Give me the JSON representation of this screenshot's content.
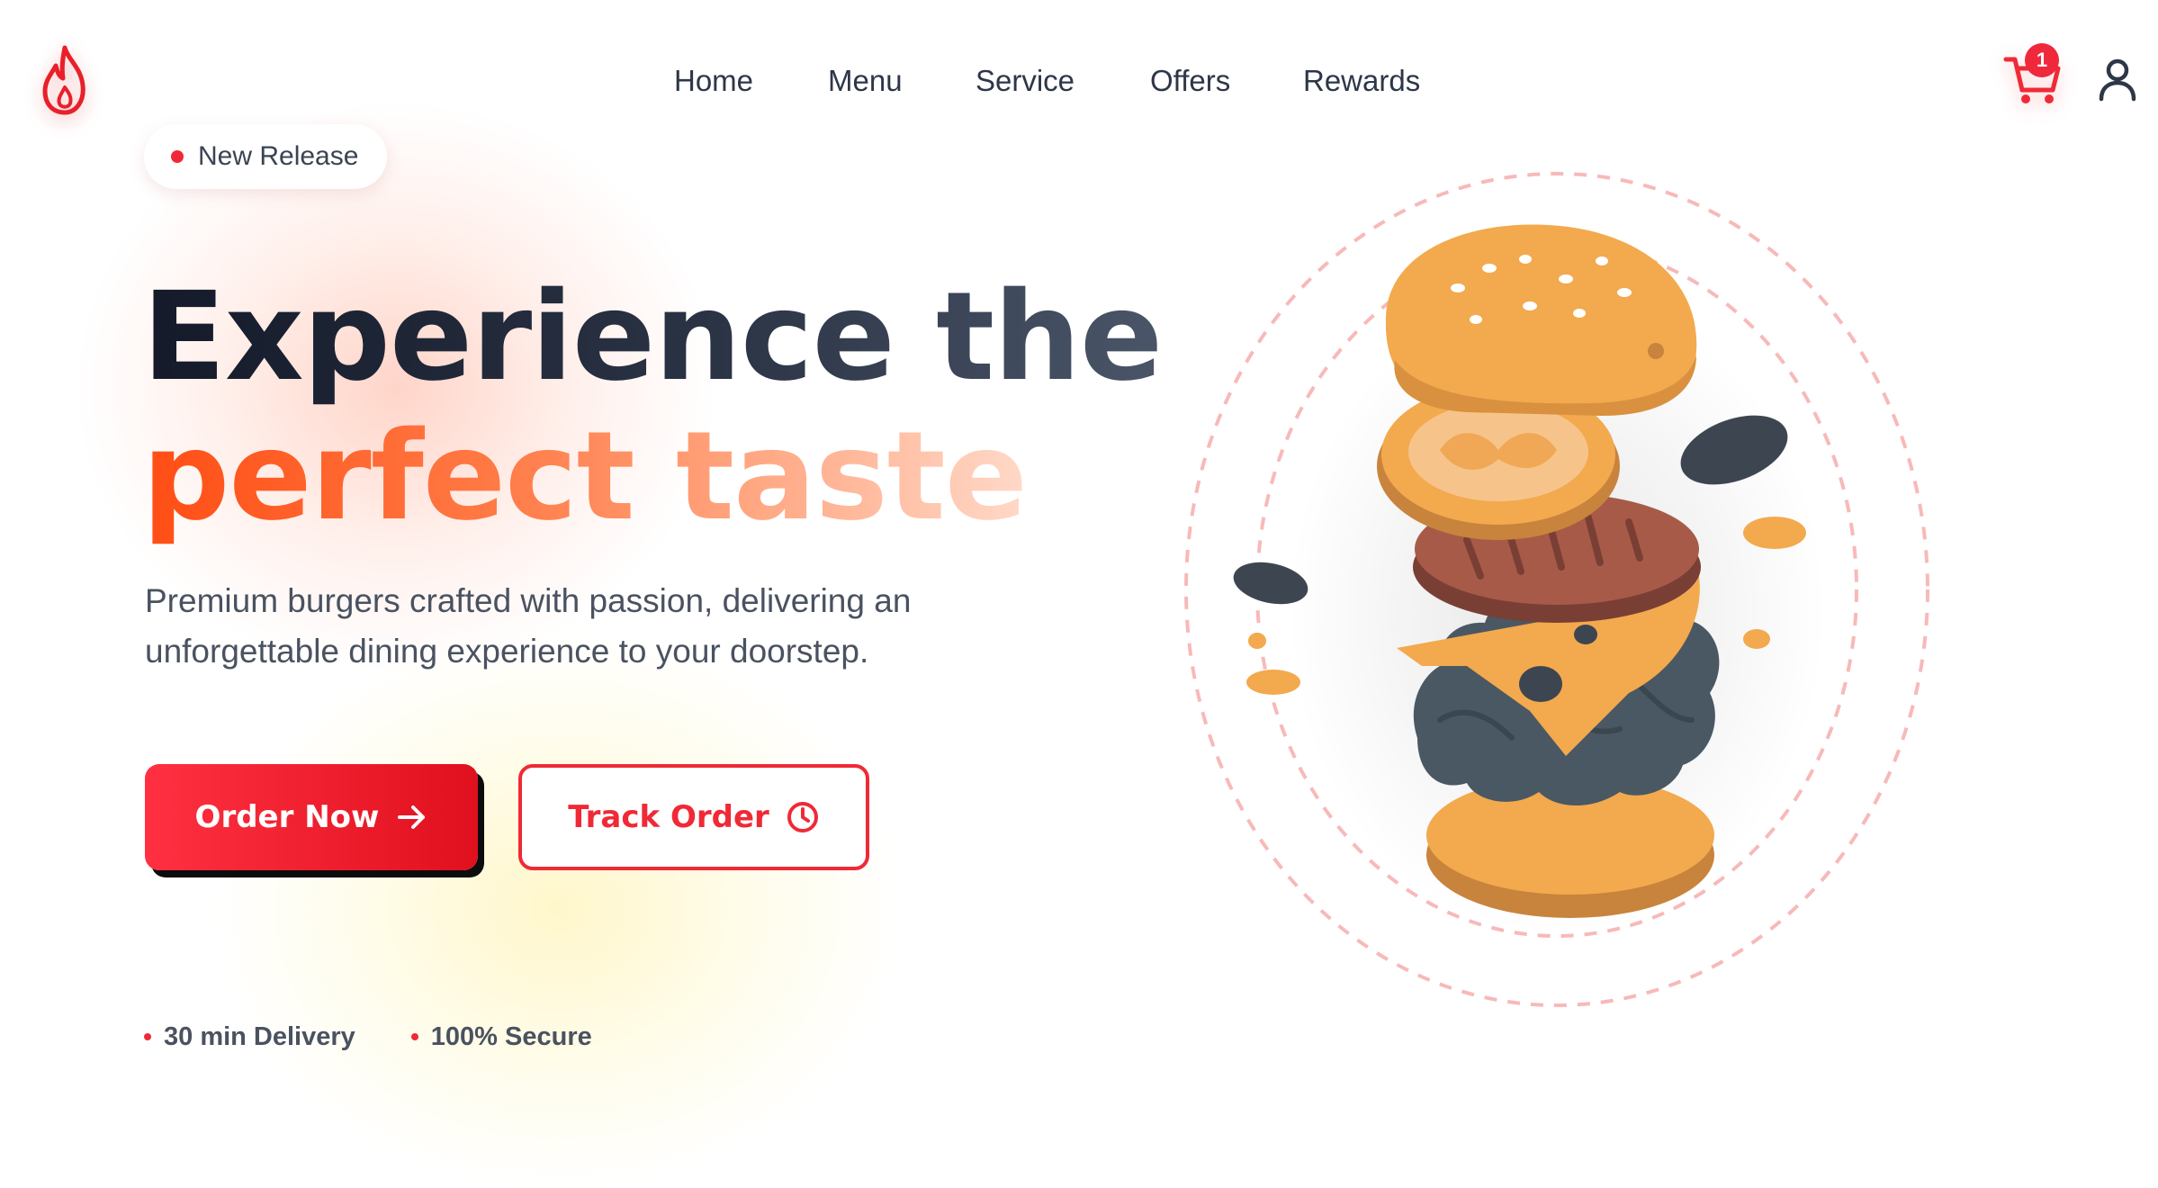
{
  "brand": {
    "logo_icon": "flame-icon",
    "accent_color": "#ef2a36"
  },
  "nav": {
    "items": [
      {
        "label": "Home"
      },
      {
        "label": "Menu"
      },
      {
        "label": "Service"
      },
      {
        "label": "Offers"
      },
      {
        "label": "Rewards"
      }
    ]
  },
  "header": {
    "cart_icon": "cart-icon",
    "cart_count": "1",
    "user_icon": "user-icon"
  },
  "hero": {
    "badge": "New Release",
    "title_line1": "Experience the",
    "title_line2": "perfect taste",
    "subtitle": "Premium burgers crafted with passion, delivering an unforgettable dining experience to your doorstep.",
    "primary_button": "Order Now",
    "secondary_button": "Track Order",
    "features": [
      "30 min Delivery",
      "100% Secure"
    ],
    "illustration": "exploded-burger-illustration"
  }
}
